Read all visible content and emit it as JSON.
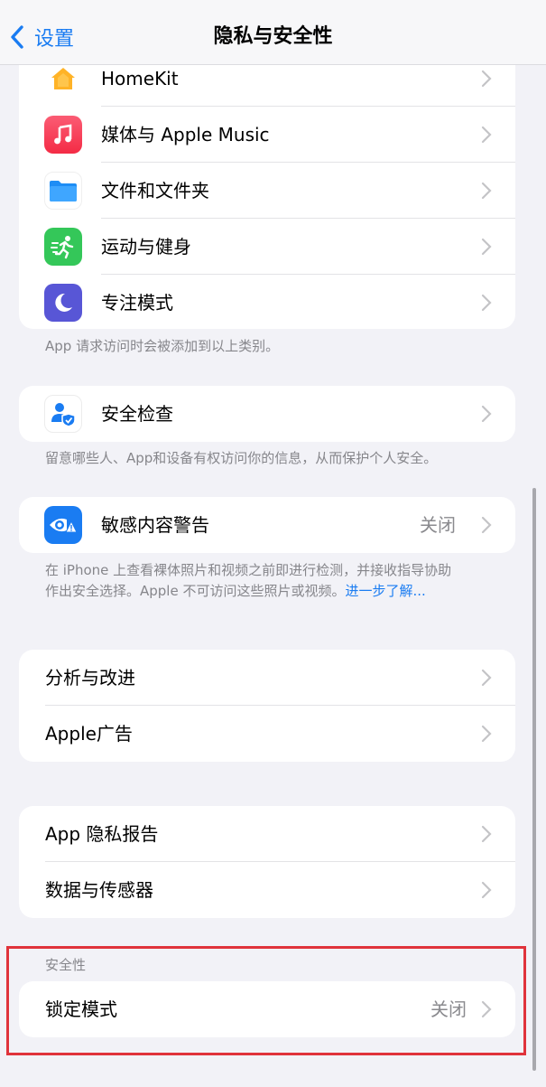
{
  "nav": {
    "back_label": "设置",
    "title": "隐私与安全性"
  },
  "group1": {
    "items": [
      {
        "label": "HomeKit",
        "icon": "homekit-icon"
      },
      {
        "label": "媒体与 Apple Music",
        "icon": "music-icon"
      },
      {
        "label": "文件和文件夹",
        "icon": "files-folder-icon"
      },
      {
        "label": "运动与健身",
        "icon": "fitness-icon"
      },
      {
        "label": "专注模式",
        "icon": "focus-moon-icon"
      }
    ],
    "footer": "App 请求访问时会被添加到以上类别。"
  },
  "safety_check": {
    "label": "安全检查",
    "icon": "safety-check-icon",
    "footer": "留意哪些人、App和设备有权访问你的信息，从而保护个人安全。"
  },
  "sensitive": {
    "label": "敏感内容警告",
    "value": "关闭",
    "icon": "sensitive-content-icon",
    "footer_text": "在 iPhone 上查看裸体照片和视频之前即进行检测，并接收指导协助作出安全选择。Apple 不可访问这些照片或视频。",
    "footer_link": "进一步了解..."
  },
  "group_analytics": {
    "items": [
      {
        "label": "分析与改进"
      },
      {
        "label": "Apple广告"
      }
    ]
  },
  "group_reports": {
    "items": [
      {
        "label": "App 隐私报告"
      },
      {
        "label": "数据与传感器"
      }
    ]
  },
  "security": {
    "header": "安全性",
    "lockdown_label": "锁定模式",
    "lockdown_value": "关闭"
  },
  "colors": {
    "accent": "#1a7cf2",
    "highlight_border": "#e0333b",
    "background": "#f2f2f7"
  }
}
